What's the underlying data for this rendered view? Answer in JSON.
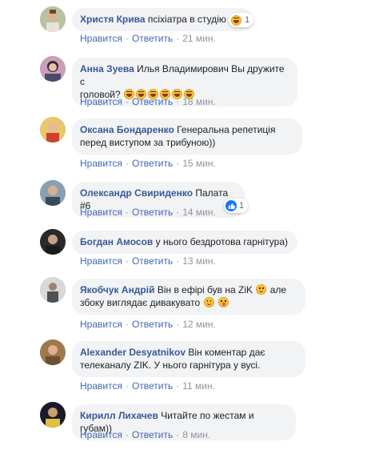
{
  "actions": {
    "like": "Нравится",
    "reply": "Ответить",
    "separator": "·"
  },
  "comments": [
    {
      "name": "Христя Крива",
      "text": "псіхіатра в студію",
      "time": "21 мин.",
      "reaction_count": "1"
    },
    {
      "name": "Анна Зуева",
      "text_line1": "Илья Владимирович Вы дружите с",
      "text_line2": "головой?",
      "time": "18 мин."
    },
    {
      "name": "Оксана Бондаренко",
      "text_line1": "Генеральна репетиція",
      "text_line2": "перед виступом за трибуною))",
      "time": "15 мин."
    },
    {
      "name": "Олександр Свириденко",
      "text": "Палата #6",
      "time": "14 мин.",
      "reaction_count": "1"
    },
    {
      "name": "Богдан Амосов",
      "text": "у нього бездротова гарнітура)",
      "time": "13 мин."
    },
    {
      "name": "Якобчук Андрій",
      "text_line1": "Він в ефірі був на ZiK",
      "text_line1b": "але",
      "text_line2": "збоку виглядає дивакувато",
      "time": "12 мин."
    },
    {
      "name": "Alexander Desyatnikov",
      "text_line1": "Він коментар дає",
      "text_line2": "телеканалу ZIK. У нього гарнітура у вусі.",
      "time": "11 мин."
    },
    {
      "name": "Кирилл Лихачев",
      "text": "Читайте по жестам и губам))",
      "time": "8 мин."
    }
  ],
  "colors": {
    "name": "#385898",
    "link": "#4267b2",
    "bubble": "#f2f3f5",
    "like": "#1877f2"
  }
}
